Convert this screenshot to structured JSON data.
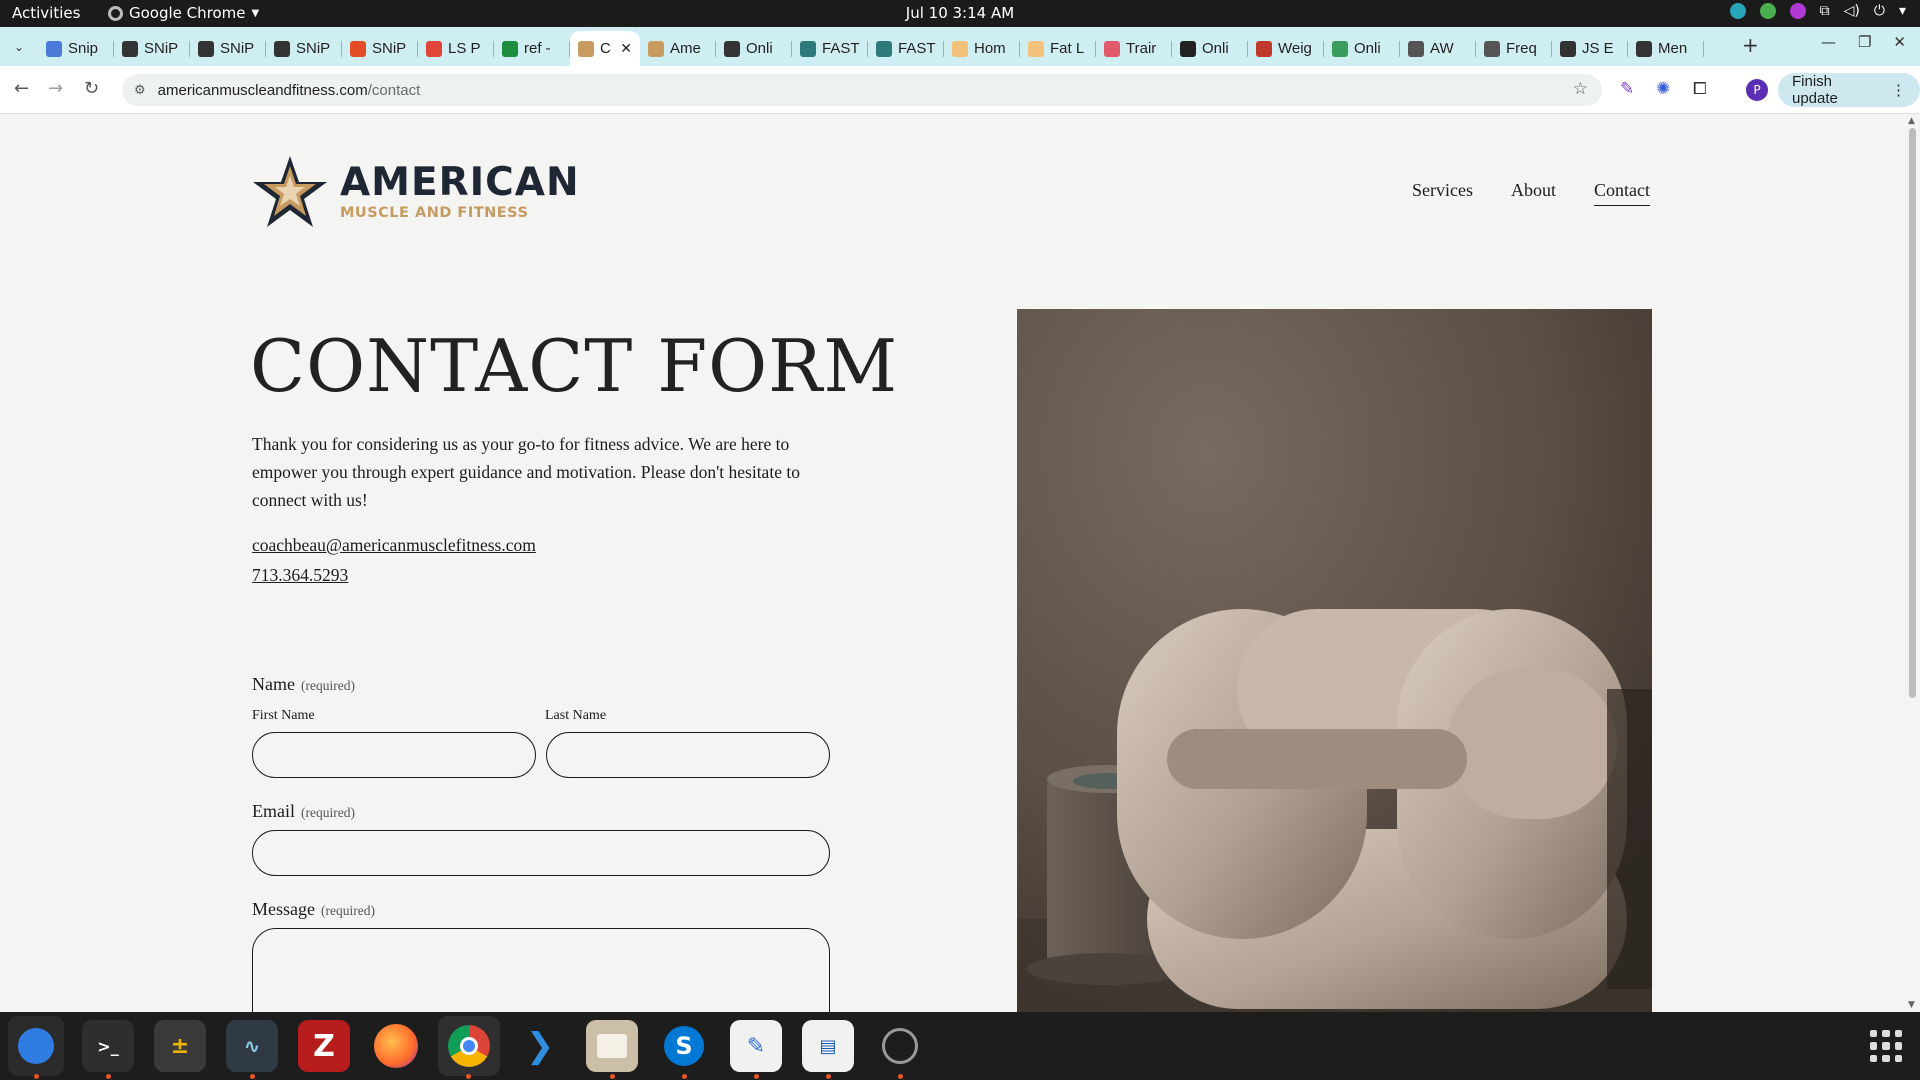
{
  "topbar": {
    "activities": "Activities",
    "app_name": "Google Chrome",
    "clock": "Jul 10  3:14 AM"
  },
  "tabs": [
    {
      "label": "Snip",
      "fav": "#4a7bd8",
      "icon": "docs-icon"
    },
    {
      "label": "SNiP",
      "fav": "#333333",
      "icon": "snip-logo-icon"
    },
    {
      "label": "SNiP",
      "fav": "#333333",
      "icon": "snip-logo-icon"
    },
    {
      "label": "SNiP",
      "fav": "#333333",
      "icon": "snip-logo-icon"
    },
    {
      "label": "SNiP",
      "fav": "#e34c26",
      "icon": "snip-color-icon"
    },
    {
      "label": "LS P",
      "fav": "#e0453a",
      "icon": "ls-icon"
    },
    {
      "label": "ref -",
      "fav": "#1e8e3e",
      "icon": "sheets-icon"
    },
    {
      "label": "C",
      "fav": "#c79a60",
      "icon": "star-favicon",
      "active": true
    },
    {
      "label": "Ame",
      "fav": "#c79a60",
      "icon": "star-favicon"
    },
    {
      "label": "Onli",
      "fav": "#333333",
      "icon": "shield-icon"
    },
    {
      "label": "FAST",
      "fav": "#2c7a7b",
      "icon": "fast-icon"
    },
    {
      "label": "FAST",
      "fav": "#2c7a7b",
      "icon": "fast-icon"
    },
    {
      "label": "Hom",
      "fav": "#f3c27a",
      "icon": "hand-icon"
    },
    {
      "label": "Fat L",
      "fav": "#f3c27a",
      "icon": "hand-icon"
    },
    {
      "label": "Trair",
      "fav": "#e05a6b",
      "icon": "heart-icon"
    },
    {
      "label": "Onli",
      "fav": "#222222",
      "icon": "person-icon"
    },
    {
      "label": "Weig",
      "fav": "#c0392b",
      "icon": "person-red-icon"
    },
    {
      "label": "Onli",
      "fav": "#3a9d5d",
      "icon": "image-icon"
    },
    {
      "label": "AW",
      "fav": "#555555",
      "icon": "chart-icon"
    },
    {
      "label": "Freq",
      "fav": "#555555",
      "icon": "chart-icon"
    },
    {
      "label": "JS E",
      "fav": "#333333",
      "icon": "shield-icon"
    },
    {
      "label": "Men",
      "fav": "#333333",
      "icon": "shield-icon"
    }
  ],
  "toolbar": {
    "url_host": "americanmuscleandfitness.com",
    "url_path": "/contact",
    "finish_update": "Finish update",
    "profile_initial": "P"
  },
  "site": {
    "logo_line1": "AMERICAN",
    "logo_line2": "MUSCLE AND FITNESS",
    "nav": [
      "Services",
      "About",
      "Contact"
    ],
    "heading": "CONTACT FORM",
    "intro": "Thank you for considering us as your go-to for fitness advice. We are here to empower you through expert guidance and motivation. Please don't hesitate to connect with us!",
    "email": "coachbeau@americanmusclefitness.com",
    "phone": "713.364.5293",
    "form": {
      "name_label": "Name",
      "required": "(required)",
      "first_name": "First Name",
      "last_name": "Last Name",
      "email_label": "Email",
      "message_label": "Message"
    },
    "accent": "#c79a60",
    "logo_dark": "#1e2733"
  }
}
